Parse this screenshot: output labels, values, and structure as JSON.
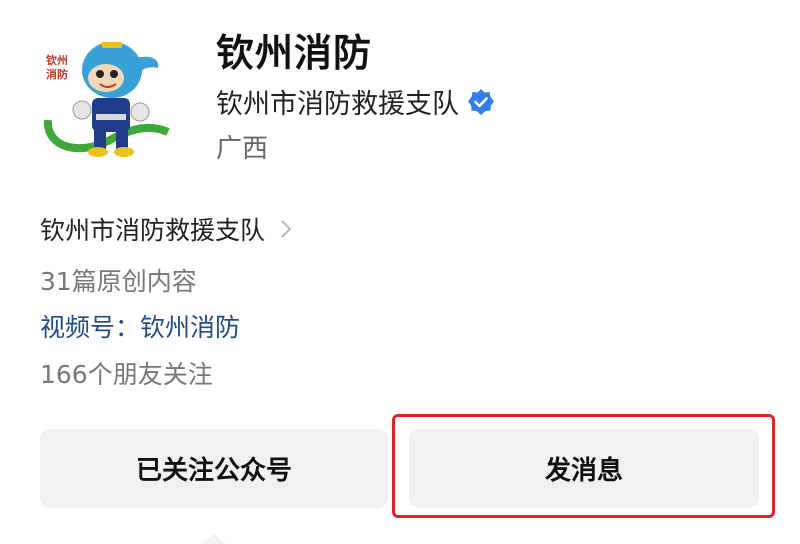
{
  "account": {
    "name": "钦州消防",
    "organization": "钦州市消防救援支队",
    "region": "广西",
    "verified_icon": "verified-badge-icon",
    "avatar_text": "钦州消防"
  },
  "details": {
    "subject_link": "钦州市消防救援支队",
    "articles": "31篇原创内容",
    "channel_label": "视频号：",
    "channel_name": "钦州消防",
    "followers": "166个朋友关注"
  },
  "buttons": {
    "follow_label": "已关注公众号",
    "message_label": "发消息"
  },
  "colors": {
    "verified": "#2f7fe6",
    "link": "#1f4b86",
    "highlight": "#e02424"
  }
}
